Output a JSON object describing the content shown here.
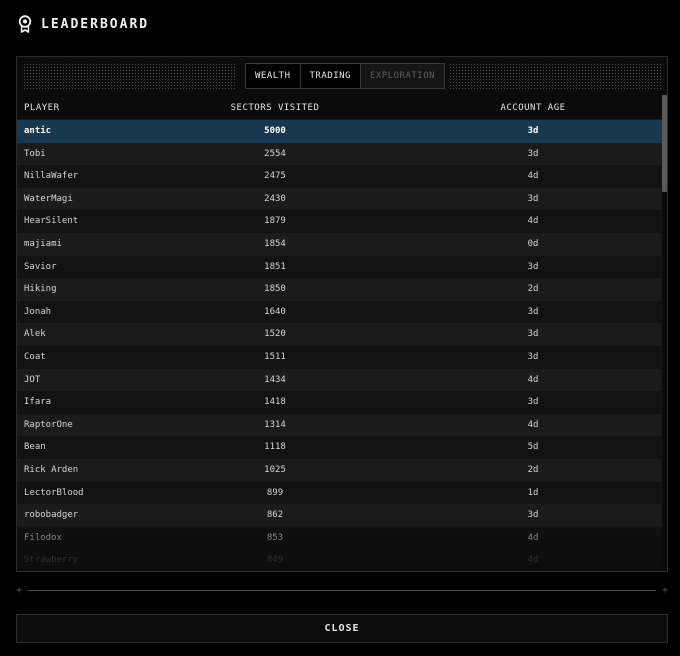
{
  "header": {
    "title": "LEADERBOARD",
    "icon": "award-ribbon-icon"
  },
  "tabs": [
    {
      "label": "WEALTH",
      "state": "active"
    },
    {
      "label": "TRADING",
      "state": "normal"
    },
    {
      "label": "EXPLORATION",
      "state": "disabled"
    }
  ],
  "table": {
    "columns": {
      "player": "PLAYER",
      "sectors": "SECTORS VISITED",
      "age": "ACCOUNT AGE"
    },
    "rows": [
      {
        "player": "antic",
        "sectors": "5000",
        "age": "3d",
        "selected": true
      },
      {
        "player": "Tobi",
        "sectors": "2554",
        "age": "3d"
      },
      {
        "player": "NillaWafer",
        "sectors": "2475",
        "age": "4d"
      },
      {
        "player": "WaterMagi",
        "sectors": "2430",
        "age": "3d"
      },
      {
        "player": "HearSilent",
        "sectors": "1879",
        "age": "4d"
      },
      {
        "player": "majiami",
        "sectors": "1854",
        "age": "0d"
      },
      {
        "player": "Savior",
        "sectors": "1851",
        "age": "3d"
      },
      {
        "player": "Hiking",
        "sectors": "1850",
        "age": "2d"
      },
      {
        "player": "Jonah",
        "sectors": "1640",
        "age": "3d"
      },
      {
        "player": "Alek",
        "sectors": "1520",
        "age": "3d"
      },
      {
        "player": "Coat",
        "sectors": "1511",
        "age": "3d"
      },
      {
        "player": "JOT",
        "sectors": "1434",
        "age": "4d"
      },
      {
        "player": "Ifara",
        "sectors": "1418",
        "age": "3d"
      },
      {
        "player": "RaptorOne",
        "sectors": "1314",
        "age": "4d"
      },
      {
        "player": "Bean",
        "sectors": "1118",
        "age": "5d"
      },
      {
        "player": "Rick Arden",
        "sectors": "1025",
        "age": "2d"
      },
      {
        "player": "LectorBlood",
        "sectors": "899",
        "age": "1d"
      },
      {
        "player": "robobadger",
        "sectors": "862",
        "age": "3d"
      },
      {
        "player": "Filodox",
        "sectors": "853",
        "age": "4d"
      },
      {
        "player": "Strawberry",
        "sectors": "849",
        "age": "4d"
      }
    ]
  },
  "close_label": "CLOSE",
  "colors": {
    "background": "#000000",
    "selected_row": "#17384f",
    "row_odd": "#121212",
    "row_even": "#1b1b1b"
  }
}
